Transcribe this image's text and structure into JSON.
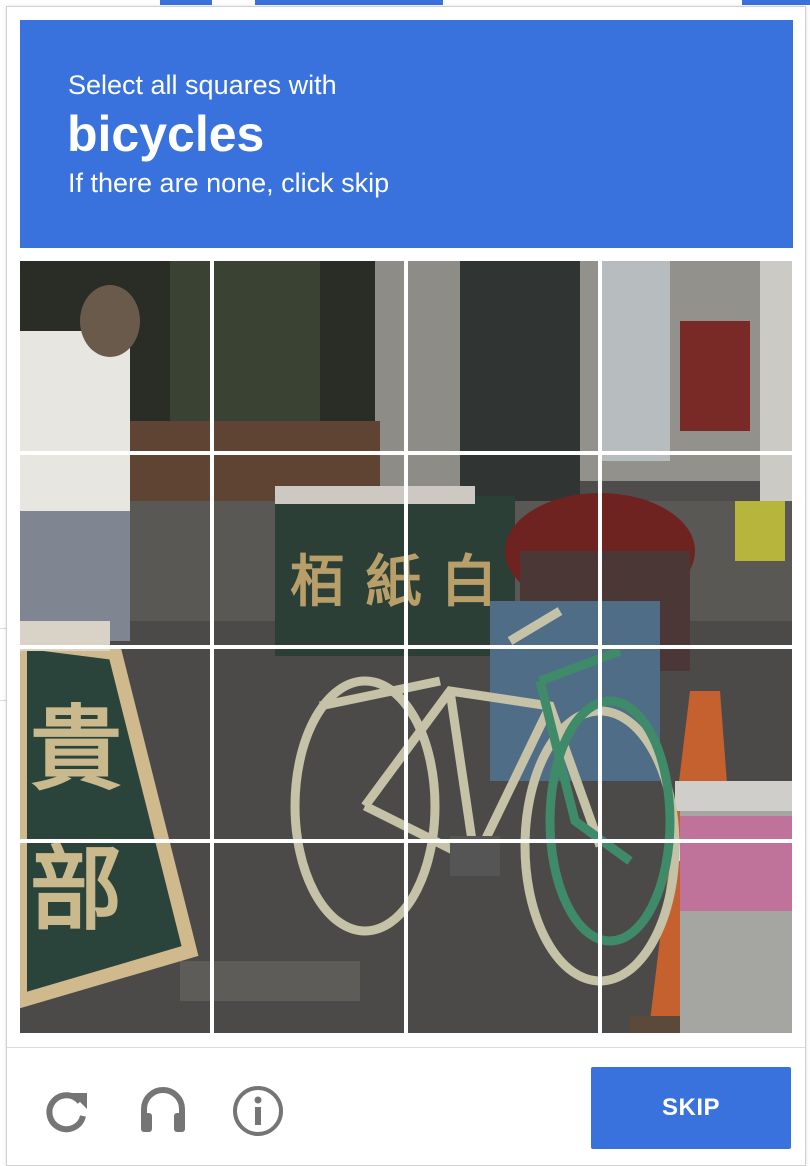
{
  "challenge": {
    "instruction_prefix": "Select all squares with",
    "target_object": "bicycles",
    "instruction_suffix": "If there are none, click skip"
  },
  "grid": {
    "rows": 4,
    "columns": 4,
    "selected_tiles": []
  },
  "controls": {
    "reload_icon": "reload-icon",
    "audio_icon": "headphones-icon",
    "info_icon": "info-icon",
    "skip_label": "SKIP"
  },
  "colors": {
    "accent": "#3a72dd",
    "icon_gray": "#757575"
  }
}
